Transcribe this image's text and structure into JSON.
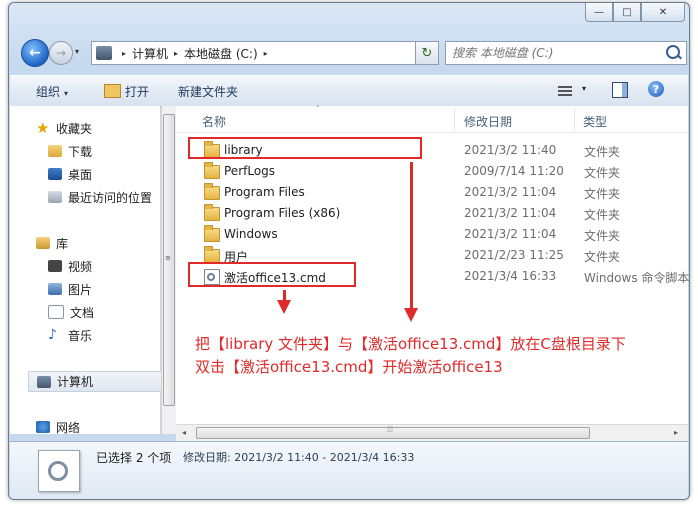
{
  "window": {
    "caption_buttons": {
      "minimize": "—",
      "maximize": "□",
      "close": "✕"
    }
  },
  "address": {
    "back_icon": "←",
    "forward_icon": "→",
    "segments": [
      "计算机",
      "本地磁盘 (C:)"
    ],
    "separator": "▸",
    "dropdown": "▾",
    "refresh_icon": "↻"
  },
  "search": {
    "placeholder": "搜索 本地磁盘 (C:)"
  },
  "toolbar": {
    "organize": "组织",
    "open": "打开",
    "new_folder": "新建文件夹",
    "dropdown": "▾",
    "help": "?"
  },
  "nav": {
    "favorites": "收藏夹",
    "favorites_items": [
      "下载",
      "桌面",
      "最近访问的位置"
    ],
    "libraries": "库",
    "library_items": [
      "视频",
      "图片",
      "文档",
      "音乐"
    ],
    "computer": "计算机",
    "network": "网络"
  },
  "columns": {
    "name": "名称",
    "date": "修改日期",
    "type": "类型",
    "sort_indicator": "˄"
  },
  "files": [
    {
      "name": "library",
      "date": "2021/3/2 11:40",
      "type": "文件夹",
      "icon": "folder-icon"
    },
    {
      "name": "PerfLogs",
      "date": "2009/7/14 11:20",
      "type": "文件夹",
      "icon": "folder-icon"
    },
    {
      "name": "Program Files",
      "date": "2021/3/2 11:04",
      "type": "文件夹",
      "icon": "folder-icon"
    },
    {
      "name": "Program Files (x86)",
      "date": "2021/3/2 11:04",
      "type": "文件夹",
      "icon": "folder-icon"
    },
    {
      "name": "Windows",
      "date": "2021/3/2 11:04",
      "type": "文件夹",
      "icon": "folder-icon"
    },
    {
      "name": "用户",
      "date": "2021/2/23 11:25",
      "type": "文件夹",
      "icon": "folder-icon"
    },
    {
      "name": "激活office13.cmd",
      "date": "2021/3/4 16:33",
      "type": "Windows 命令脚本",
      "icon": "cmd-script-icon"
    }
  ],
  "annotation": {
    "line1": "把【library 文件夹】与【激活office13.cmd】放在C盘根目录下",
    "line2": "双击【激活office13.cmd】开始激活office13",
    "color": "#e02a2a"
  },
  "scroll": {
    "left": "◂",
    "right": "▸",
    "grip": "⦙⦙⦙"
  },
  "details": {
    "selection": "已选择 2 个项",
    "date_range": "修改日期: 2021/3/2 11:40 - 2021/3/4 16:33"
  }
}
